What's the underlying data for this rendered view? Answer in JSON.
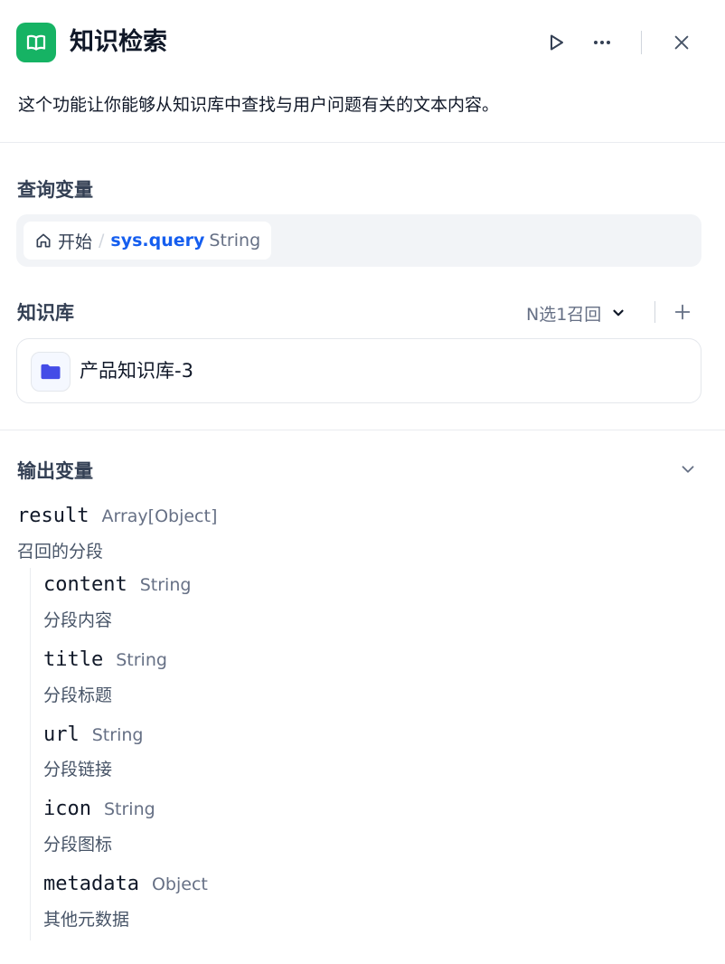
{
  "header": {
    "title": "知识检索",
    "description": "这个功能让你能够从知识库中查找与用户问题有关的文本内容。",
    "icons": {
      "node": "book-open-icon",
      "run": "play-icon",
      "more": "more-horizontal-icon",
      "close": "close-icon"
    },
    "accent": "#16b364"
  },
  "query": {
    "label": "查询变量",
    "node_name": "开始",
    "separator": "/",
    "var_name": "sys.query",
    "var_type": "String"
  },
  "knowledge": {
    "label": "知识库",
    "mode": "N选1召回",
    "datasets": [
      {
        "name": "产品知识库-3",
        "icon": "folder-icon"
      }
    ]
  },
  "output": {
    "label": "输出变量",
    "root": {
      "name": "result",
      "type": "Array[Object]",
      "desc": "召回的分段"
    },
    "children": [
      {
        "name": "content",
        "type": "String",
        "desc": "分段内容"
      },
      {
        "name": "title",
        "type": "String",
        "desc": "分段标题"
      },
      {
        "name": "url",
        "type": "String",
        "desc": "分段链接"
      },
      {
        "name": "icon",
        "type": "String",
        "desc": "分段图标"
      },
      {
        "name": "metadata",
        "type": "Object",
        "desc": "其他元数据"
      }
    ]
  }
}
